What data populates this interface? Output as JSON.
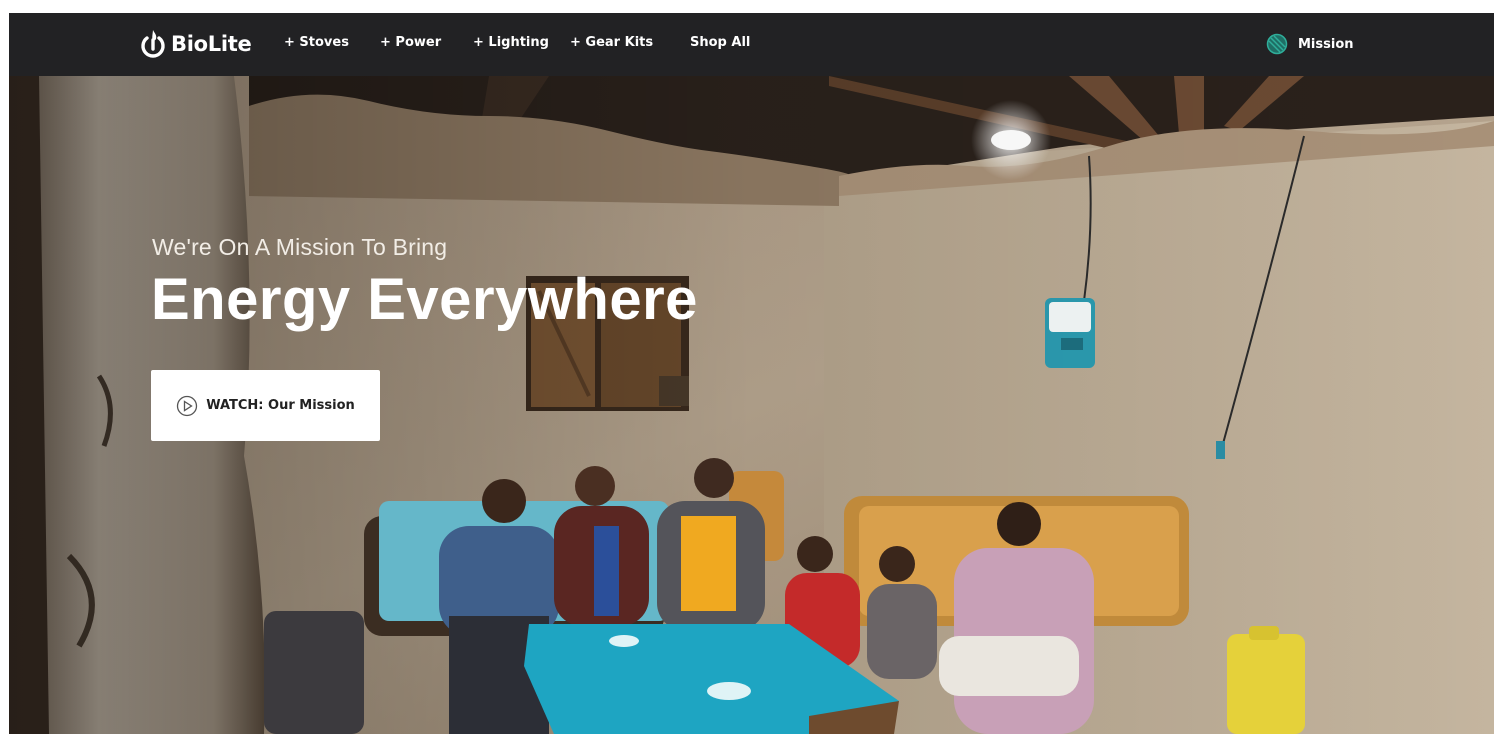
{
  "nav": {
    "logo_text": "BioLite",
    "items": [
      "+ Stoves",
      "+ Power",
      "+ Lighting",
      "+ Gear Kits",
      "Shop All"
    ],
    "mission_label": "Mission"
  },
  "hero": {
    "kicker": "We're On A Mission To Bring",
    "headline": "Energy Everywhere",
    "cta_label": "WATCH: Our Mission"
  },
  "colors": {
    "nav_bg": "#222224",
    "mission_icon": "#2fae9a",
    "cta_bg": "#ffffff"
  },
  "icons": {
    "logo": "flame-power-icon",
    "mission": "globe-icon",
    "cta": "play-circle-icon"
  }
}
